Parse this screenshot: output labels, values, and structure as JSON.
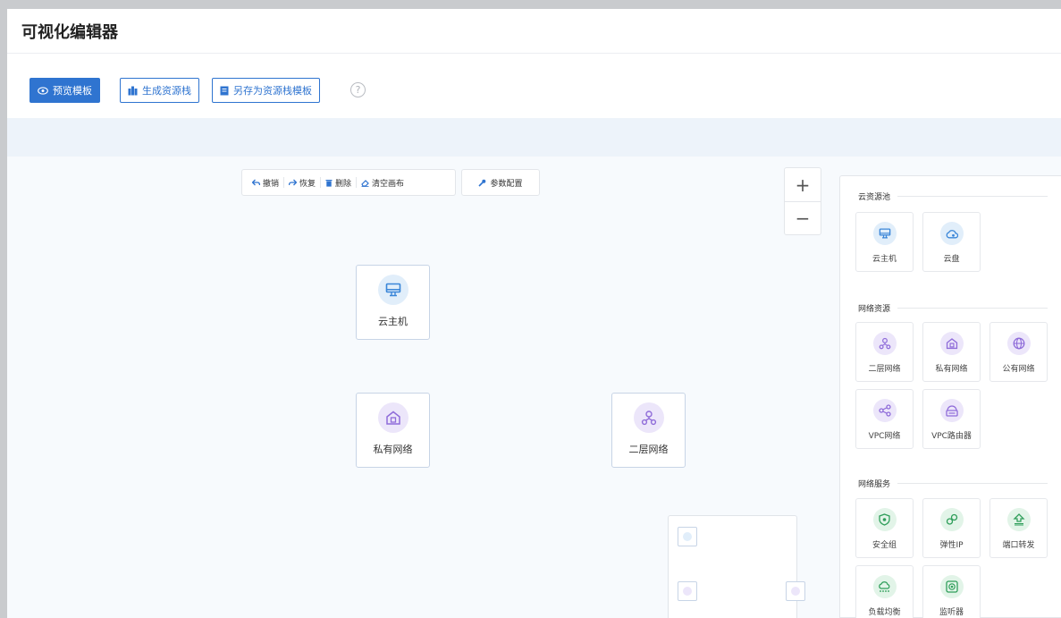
{
  "page": {
    "title": "可视化编辑器"
  },
  "toolbar": {
    "preview": "预览模板",
    "generate": "生成资源栈",
    "save_as": "另存为资源栈模板",
    "help": "?"
  },
  "edit_bar": {
    "undo": "撤销",
    "redo": "恢复",
    "delete": "删除",
    "clear": "清空画布",
    "params": "参数配置"
  },
  "zoom": {
    "in": "+",
    "out": "−"
  },
  "canvas_nodes": [
    {
      "label": "云主机",
      "icon": "monitor-icon"
    },
    {
      "label": "私有网络",
      "icon": "private-network-icon"
    },
    {
      "label": "二层网络",
      "icon": "l2-network-icon"
    }
  ],
  "palette": {
    "groups": [
      {
        "title": "云资源池",
        "items": [
          "云主机",
          "云盘"
        ]
      },
      {
        "title": "网络资源",
        "items": [
          "二层网络",
          "私有网络",
          "公有网络",
          "VPC网络",
          "VPC路由器"
        ]
      },
      {
        "title": "网络服务",
        "items": [
          "安全组",
          "弹性IP",
          "端口转发",
          "负载均衡",
          "监听器"
        ]
      }
    ]
  },
  "colors": {
    "primary": "#2f74d0",
    "icon_blue": "#3a86d8",
    "icon_purple": "#8f6cd9",
    "icon_green": "#2f9e5a"
  }
}
